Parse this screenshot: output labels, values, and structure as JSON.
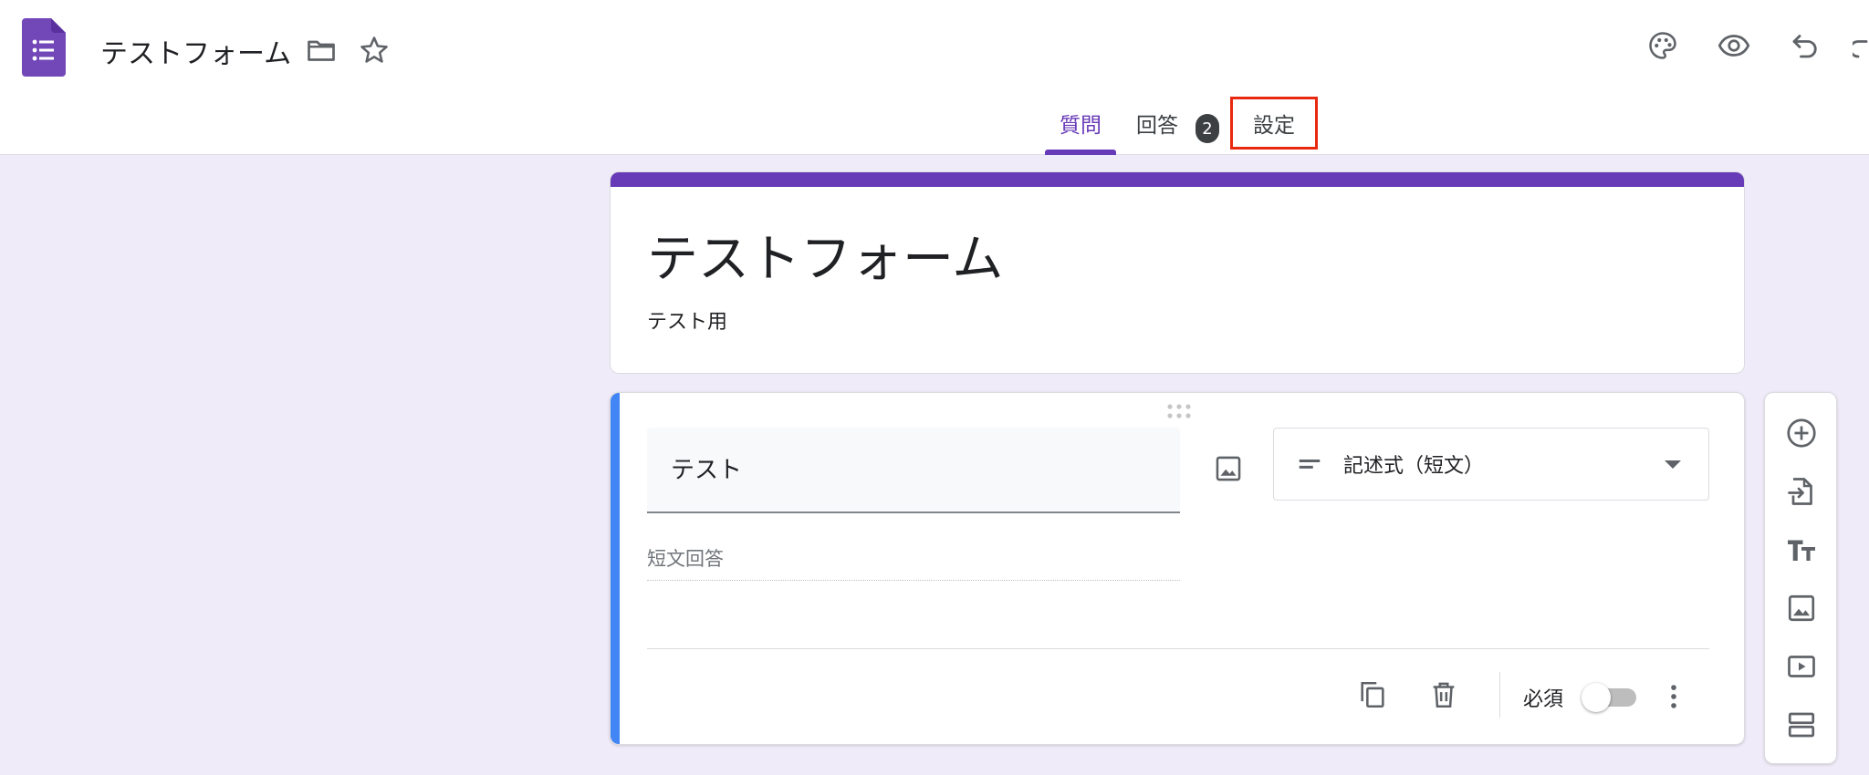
{
  "header": {
    "doc_title": "テストフォーム",
    "icons": [
      "forms-logo-icon",
      "folder-icon",
      "star-icon",
      "palette-icon",
      "eye-icon",
      "undo-icon",
      "redo-icon"
    ]
  },
  "tabs": {
    "questions": "質問",
    "responses": "回答",
    "responses_count": "2",
    "settings": "設定"
  },
  "form": {
    "title": "テストフォーム",
    "description": "テスト用"
  },
  "question": {
    "title": "テスト",
    "type_label": "記述式（短文）",
    "answer_placeholder": "短文回答",
    "required_label": "必須",
    "required": false
  },
  "side_toolbar": {
    "icons": [
      "add-circle-icon",
      "import-icon",
      "title-text-icon",
      "image-icon",
      "video-icon",
      "section-icon"
    ]
  },
  "colors": {
    "accent": "#673ab7",
    "question_bar": "#4285f4",
    "background": "#f0ebf8",
    "highlight": "#e8290f"
  }
}
